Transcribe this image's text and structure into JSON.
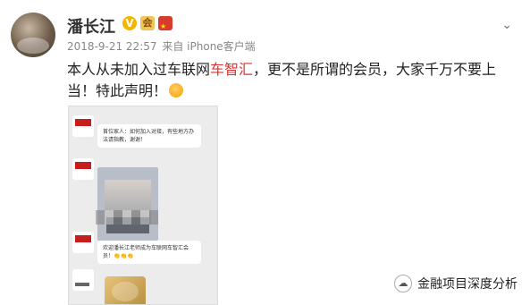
{
  "post": {
    "username": "潘长江",
    "badges": [
      "V",
      "会",
      "flag"
    ],
    "dropdown_icon": "chevron-down-icon",
    "timestamp": "2018-9-21 22:57",
    "via_prefix": "来自",
    "via_device": "iPhone客户端",
    "text_before": "本人从未加入过车联网",
    "text_highlight": "车智汇",
    "text_after": "，更不是所谓的会员，大家千万不要上当！特此声明！",
    "emoji": "angry-face"
  },
  "screenshot": {
    "messages": [
      {
        "kind": "text",
        "meta": "",
        "text": "首位家人：如何加入对接，有些地方办法请指教，谢谢！"
      },
      {
        "kind": "photo",
        "meta": "",
        "text": ""
      },
      {
        "kind": "text",
        "meta": "",
        "text": "欢迎潘长江老师成为车联网车智汇会员！👏👏👏"
      },
      {
        "kind": "image",
        "meta": "",
        "text": ""
      }
    ]
  },
  "watermark": {
    "text": "金融项目深度分析"
  }
}
